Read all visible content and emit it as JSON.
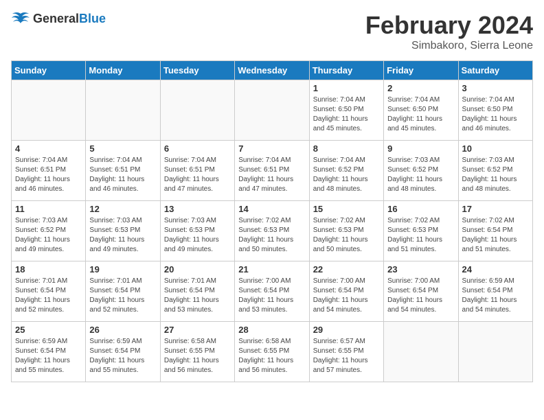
{
  "header": {
    "logo_general": "General",
    "logo_blue": "Blue",
    "month_year": "February 2024",
    "location": "Simbakoro, Sierra Leone"
  },
  "weekdays": [
    "Sunday",
    "Monday",
    "Tuesday",
    "Wednesday",
    "Thursday",
    "Friday",
    "Saturday"
  ],
  "weeks": [
    [
      {
        "day": "",
        "sunrise": "",
        "sunset": "",
        "daylight": ""
      },
      {
        "day": "",
        "sunrise": "",
        "sunset": "",
        "daylight": ""
      },
      {
        "day": "",
        "sunrise": "",
        "sunset": "",
        "daylight": ""
      },
      {
        "day": "",
        "sunrise": "",
        "sunset": "",
        "daylight": ""
      },
      {
        "day": "1",
        "sunrise": "Sunrise: 7:04 AM",
        "sunset": "Sunset: 6:50 PM",
        "daylight": "Daylight: 11 hours and 45 minutes."
      },
      {
        "day": "2",
        "sunrise": "Sunrise: 7:04 AM",
        "sunset": "Sunset: 6:50 PM",
        "daylight": "Daylight: 11 hours and 45 minutes."
      },
      {
        "day": "3",
        "sunrise": "Sunrise: 7:04 AM",
        "sunset": "Sunset: 6:50 PM",
        "daylight": "Daylight: 11 hours and 46 minutes."
      }
    ],
    [
      {
        "day": "4",
        "sunrise": "Sunrise: 7:04 AM",
        "sunset": "Sunset: 6:51 PM",
        "daylight": "Daylight: 11 hours and 46 minutes."
      },
      {
        "day": "5",
        "sunrise": "Sunrise: 7:04 AM",
        "sunset": "Sunset: 6:51 PM",
        "daylight": "Daylight: 11 hours and 46 minutes."
      },
      {
        "day": "6",
        "sunrise": "Sunrise: 7:04 AM",
        "sunset": "Sunset: 6:51 PM",
        "daylight": "Daylight: 11 hours and 47 minutes."
      },
      {
        "day": "7",
        "sunrise": "Sunrise: 7:04 AM",
        "sunset": "Sunset: 6:51 PM",
        "daylight": "Daylight: 11 hours and 47 minutes."
      },
      {
        "day": "8",
        "sunrise": "Sunrise: 7:04 AM",
        "sunset": "Sunset: 6:52 PM",
        "daylight": "Daylight: 11 hours and 48 minutes."
      },
      {
        "day": "9",
        "sunrise": "Sunrise: 7:03 AM",
        "sunset": "Sunset: 6:52 PM",
        "daylight": "Daylight: 11 hours and 48 minutes."
      },
      {
        "day": "10",
        "sunrise": "Sunrise: 7:03 AM",
        "sunset": "Sunset: 6:52 PM",
        "daylight": "Daylight: 11 hours and 48 minutes."
      }
    ],
    [
      {
        "day": "11",
        "sunrise": "Sunrise: 7:03 AM",
        "sunset": "Sunset: 6:52 PM",
        "daylight": "Daylight: 11 hours and 49 minutes."
      },
      {
        "day": "12",
        "sunrise": "Sunrise: 7:03 AM",
        "sunset": "Sunset: 6:53 PM",
        "daylight": "Daylight: 11 hours and 49 minutes."
      },
      {
        "day": "13",
        "sunrise": "Sunrise: 7:03 AM",
        "sunset": "Sunset: 6:53 PM",
        "daylight": "Daylight: 11 hours and 49 minutes."
      },
      {
        "day": "14",
        "sunrise": "Sunrise: 7:02 AM",
        "sunset": "Sunset: 6:53 PM",
        "daylight": "Daylight: 11 hours and 50 minutes."
      },
      {
        "day": "15",
        "sunrise": "Sunrise: 7:02 AM",
        "sunset": "Sunset: 6:53 PM",
        "daylight": "Daylight: 11 hours and 50 minutes."
      },
      {
        "day": "16",
        "sunrise": "Sunrise: 7:02 AM",
        "sunset": "Sunset: 6:53 PM",
        "daylight": "Daylight: 11 hours and 51 minutes."
      },
      {
        "day": "17",
        "sunrise": "Sunrise: 7:02 AM",
        "sunset": "Sunset: 6:54 PM",
        "daylight": "Daylight: 11 hours and 51 minutes."
      }
    ],
    [
      {
        "day": "18",
        "sunrise": "Sunrise: 7:01 AM",
        "sunset": "Sunset: 6:54 PM",
        "daylight": "Daylight: 11 hours and 52 minutes."
      },
      {
        "day": "19",
        "sunrise": "Sunrise: 7:01 AM",
        "sunset": "Sunset: 6:54 PM",
        "daylight": "Daylight: 11 hours and 52 minutes."
      },
      {
        "day": "20",
        "sunrise": "Sunrise: 7:01 AM",
        "sunset": "Sunset: 6:54 PM",
        "daylight": "Daylight: 11 hours and 53 minutes."
      },
      {
        "day": "21",
        "sunrise": "Sunrise: 7:00 AM",
        "sunset": "Sunset: 6:54 PM",
        "daylight": "Daylight: 11 hours and 53 minutes."
      },
      {
        "day": "22",
        "sunrise": "Sunrise: 7:00 AM",
        "sunset": "Sunset: 6:54 PM",
        "daylight": "Daylight: 11 hours and 54 minutes."
      },
      {
        "day": "23",
        "sunrise": "Sunrise: 7:00 AM",
        "sunset": "Sunset: 6:54 PM",
        "daylight": "Daylight: 11 hours and 54 minutes."
      },
      {
        "day": "24",
        "sunrise": "Sunrise: 6:59 AM",
        "sunset": "Sunset: 6:54 PM",
        "daylight": "Daylight: 11 hours and 54 minutes."
      }
    ],
    [
      {
        "day": "25",
        "sunrise": "Sunrise: 6:59 AM",
        "sunset": "Sunset: 6:54 PM",
        "daylight": "Daylight: 11 hours and 55 minutes."
      },
      {
        "day": "26",
        "sunrise": "Sunrise: 6:59 AM",
        "sunset": "Sunset: 6:54 PM",
        "daylight": "Daylight: 11 hours and 55 minutes."
      },
      {
        "day": "27",
        "sunrise": "Sunrise: 6:58 AM",
        "sunset": "Sunset: 6:55 PM",
        "daylight": "Daylight: 11 hours and 56 minutes."
      },
      {
        "day": "28",
        "sunrise": "Sunrise: 6:58 AM",
        "sunset": "Sunset: 6:55 PM",
        "daylight": "Daylight: 11 hours and 56 minutes."
      },
      {
        "day": "29",
        "sunrise": "Sunrise: 6:57 AM",
        "sunset": "Sunset: 6:55 PM",
        "daylight": "Daylight: 11 hours and 57 minutes."
      },
      {
        "day": "",
        "sunrise": "",
        "sunset": "",
        "daylight": ""
      },
      {
        "day": "",
        "sunrise": "",
        "sunset": "",
        "daylight": ""
      }
    ]
  ]
}
